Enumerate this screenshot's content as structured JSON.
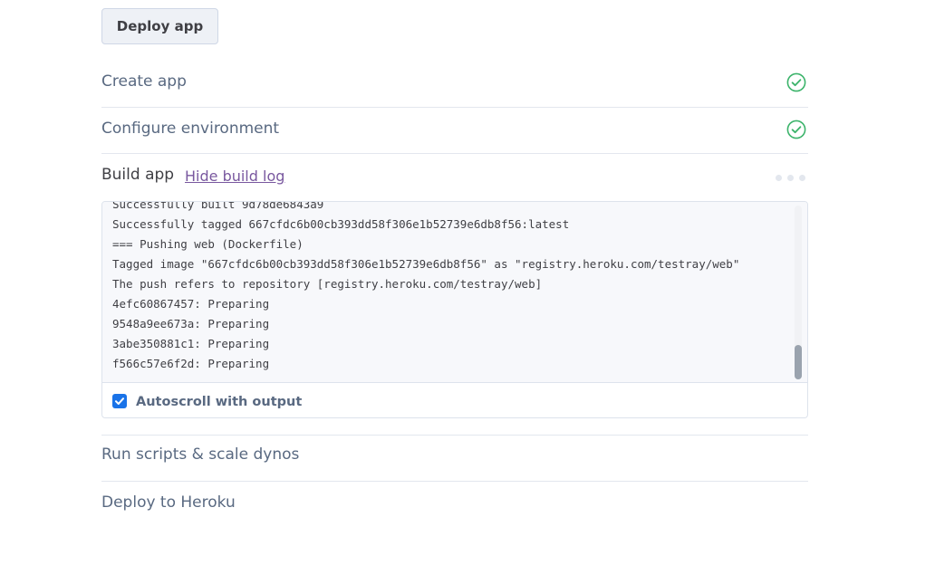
{
  "deploy_button": {
    "label": "Deploy app"
  },
  "steps": [
    {
      "label": "Create app",
      "status": "complete"
    },
    {
      "label": "Configure environment",
      "status": "complete"
    },
    {
      "label": "Build app",
      "status": "in-progress",
      "action_label": "Hide build log"
    },
    {
      "label": "Run scripts & scale dynos",
      "status": "pending"
    },
    {
      "label": "Deploy to Heroku",
      "status": "pending"
    }
  ],
  "build_log": {
    "lines": [
      "Successfully built 9d78de6843a9",
      "Successfully tagged 667cfdc6b00cb393dd58f306e1b52739e6db8f56:latest",
      "=== Pushing web (Dockerfile)",
      "Tagged image \"667cfdc6b00cb393dd58f306e1b52739e6db8f56\" as \"registry.heroku.com/testray/web\"",
      "The push refers to repository [registry.heroku.com/testray/web]",
      "4efc60867457: Preparing",
      "9548a9ee673a: Preparing",
      "3abe350881c1: Preparing",
      "f566c57e6f2d: Preparing"
    ],
    "autoscroll_label": "Autoscroll with output",
    "autoscroll_checked": true
  },
  "colors": {
    "check_green": "#3bb36a",
    "link_purple": "#79589f",
    "checkbox_blue": "#1a73e8"
  },
  "icons": {
    "complete": "check-circle-icon",
    "in_progress": "loading-dots-icon",
    "checkbox": "checkmark-icon"
  }
}
